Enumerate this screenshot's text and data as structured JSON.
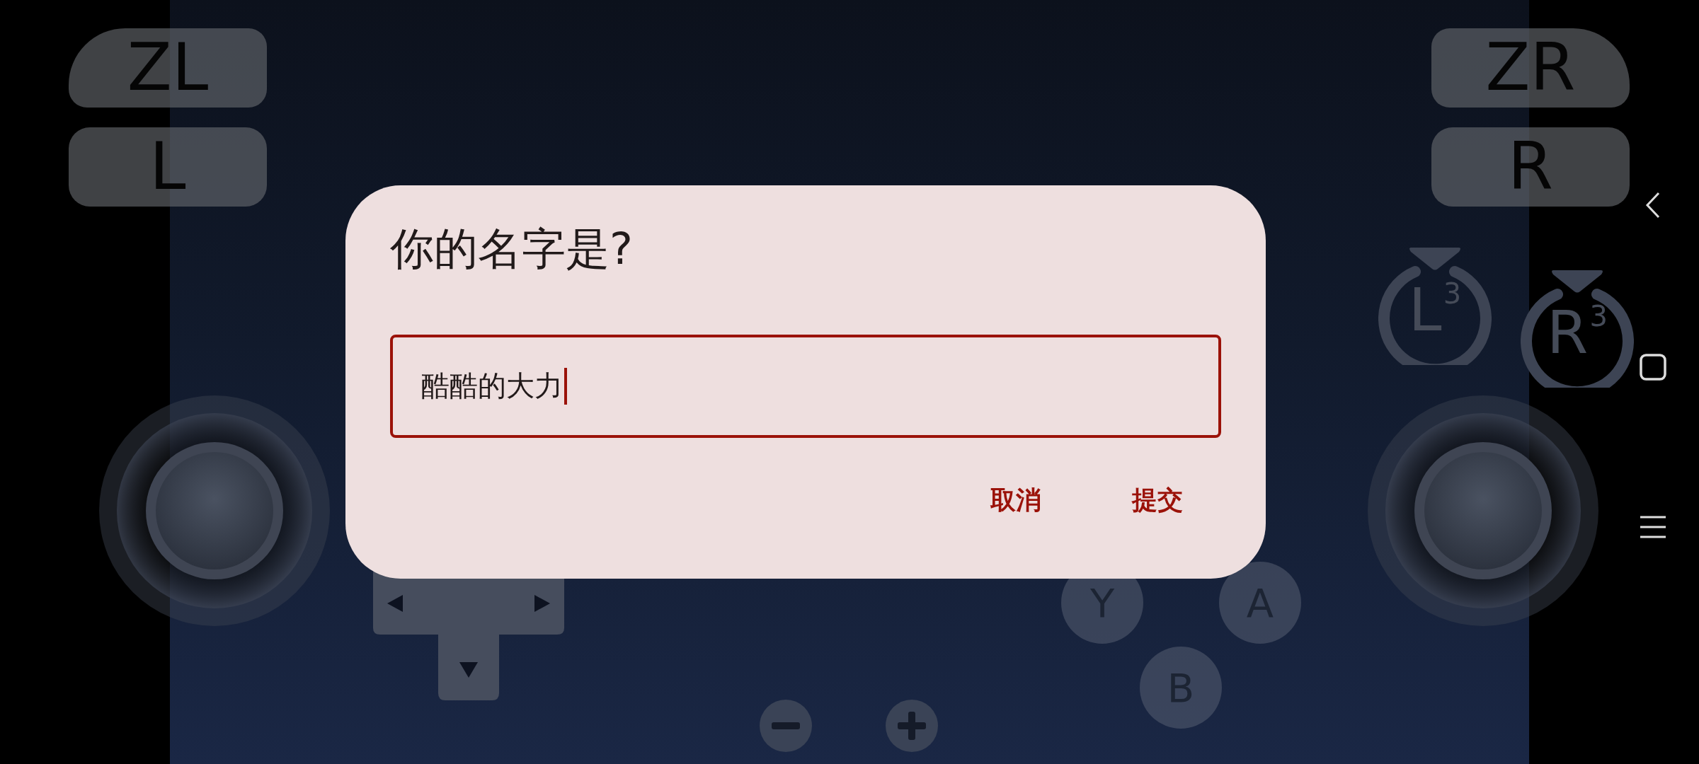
{
  "shoulders": {
    "left": [
      "ZL",
      "L"
    ],
    "right": [
      "ZR",
      "R"
    ]
  },
  "stick_buttons": [
    "L$^{3}$",
    "R$^{3}$"
  ],
  "face_buttons": [
    "Y",
    "A",
    "B"
  ],
  "dialog": {
    "title": "你的名字是?",
    "input": {
      "value": "酷酷的大力",
      "focused": true
    },
    "buttons": [
      {
        "label": "取消"
      },
      {
        "label": "提交"
      }
    ]
  }
}
